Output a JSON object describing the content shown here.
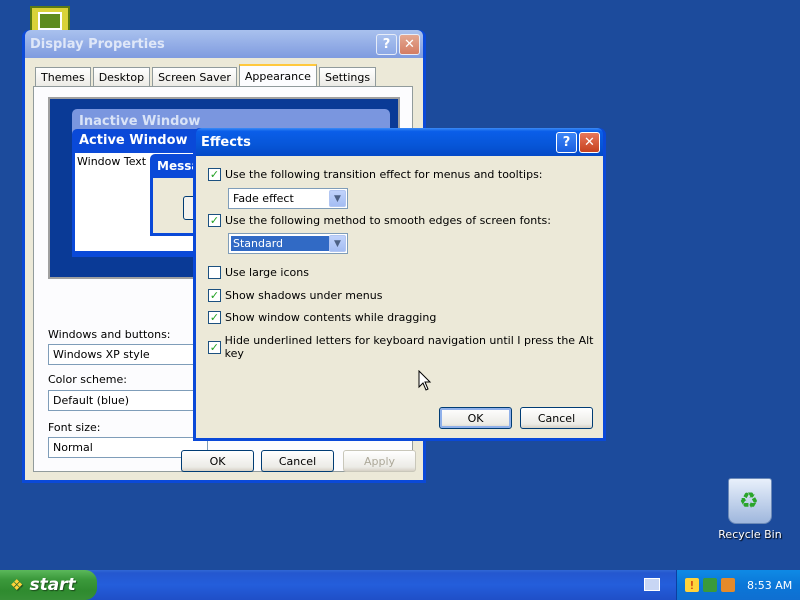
{
  "desktop": {
    "recycle_bin_label": "Recycle Bin"
  },
  "display_properties": {
    "title": "Display Properties",
    "tabs": [
      {
        "label": "Themes"
      },
      {
        "label": "Desktop"
      },
      {
        "label": "Screen Saver"
      },
      {
        "label": "Appearance"
      },
      {
        "label": "Settings"
      }
    ],
    "active_tab": "Appearance",
    "preview": {
      "inactive_title": "Inactive Window",
      "active_title": "Active Window",
      "window_text": "Window Text",
      "message_title": "Message Box"
    },
    "windows_buttons_label": "Windows and buttons:",
    "windows_buttons_value": "Windows XP style",
    "color_scheme_label": "Color scheme:",
    "color_scheme_value": "Default (blue)",
    "font_size_label": "Font size:",
    "font_size_value": "Normal",
    "ok_label": "OK",
    "cancel_label": "Cancel",
    "apply_label": "Apply"
  },
  "effects": {
    "title": "Effects",
    "help_glyph": "?",
    "close_glyph": "✕",
    "options": [
      {
        "label": "Use the following transition effect for menus and tooltips:",
        "checked": true
      },
      {
        "label": "Use the following method to smooth edges of screen fonts:",
        "checked": true
      },
      {
        "label": "Use large icons",
        "checked": false
      },
      {
        "label": "Show shadows under menus",
        "checked": true
      },
      {
        "label": "Show window contents while dragging",
        "checked": true
      },
      {
        "label": "Hide underlined letters for keyboard navigation until I press the Alt key",
        "checked": true
      }
    ],
    "transition_value": "Fade effect",
    "smoothing_value": "Standard",
    "ok_label": "OK",
    "cancel_label": "Cancel"
  },
  "taskbar": {
    "start_label": "start",
    "clock": "8:53 AM"
  }
}
